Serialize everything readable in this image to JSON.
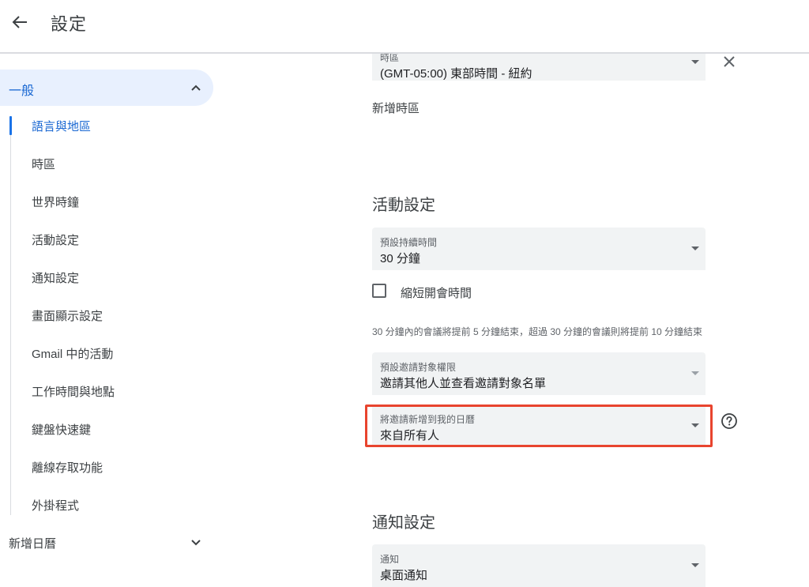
{
  "header": {
    "back_icon": "arrow-back-icon",
    "title": "設定"
  },
  "sidebar": {
    "general": {
      "label": "一般",
      "expanded": true,
      "icon": "chevron-up-icon"
    },
    "items": [
      {
        "label": "語言與地區",
        "active": true
      },
      {
        "label": "時區"
      },
      {
        "label": "世界時鐘"
      },
      {
        "label": "活動設定"
      },
      {
        "label": "通知設定"
      },
      {
        "label": "畫面顯示設定"
      },
      {
        "label": "Gmail 中的活動"
      },
      {
        "label": "工作時間與地點"
      },
      {
        "label": "鍵盤快速鍵"
      },
      {
        "label": "離線存取功能"
      },
      {
        "label": "外掛程式"
      }
    ],
    "add_calendar": {
      "label": "新增日曆",
      "expanded": false,
      "icon": "chevron-down-icon"
    }
  },
  "main": {
    "timezone": {
      "label": "時區",
      "value": "(GMT-05:00) 東部時間 - 紐約"
    },
    "add_timezone": "新增時區",
    "event_settings": {
      "title": "活動設定",
      "default_duration": {
        "label": "預設持續時間",
        "value": "30 分鐘"
      },
      "speedy_meetings": {
        "label": "縮短開會時間",
        "checked": false
      },
      "helper_text": "30 分鐘內的會議將提前 5 分鐘結束，超過 30 分鐘的會議則將提前 10 分鐘結束",
      "guest_permissions": {
        "label": "預設邀請對象權限",
        "value": "邀請其他人並查看邀請對象名單"
      },
      "add_invitations": {
        "label": "將邀請新增到我的日曆",
        "value": "來自所有人"
      }
    },
    "notification_settings": {
      "title": "通知設定",
      "notification": {
        "label": "通知",
        "value": "桌面通知"
      }
    }
  },
  "colors": {
    "accent": "#1a73e8",
    "highlight_border": "#e8442e",
    "field_bg": "#f1f3f4",
    "nav_active_bg": "#e8f0fe"
  }
}
